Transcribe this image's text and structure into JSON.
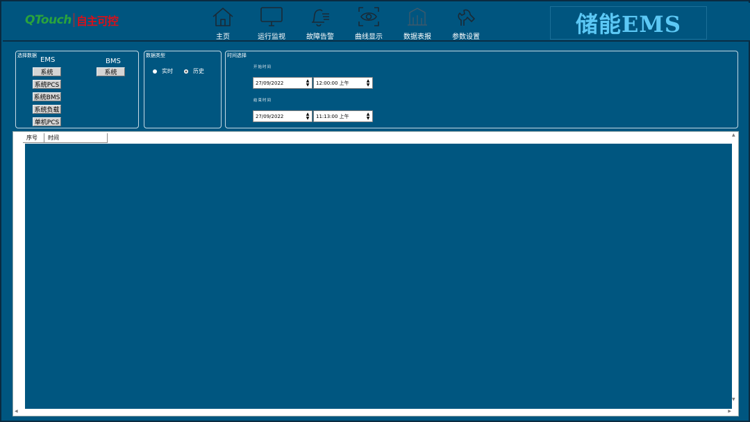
{
  "header": {
    "logo_latin": "QTouch",
    "logo_cn": "自主可控",
    "title": "储能EMS",
    "nav": [
      {
        "label": "主页",
        "icon": "home-icon"
      },
      {
        "label": "运行监视",
        "icon": "monitor-icon"
      },
      {
        "label": "故障告警",
        "icon": "alarm-bell-icon"
      },
      {
        "label": "曲线显示",
        "icon": "eye-scan-icon"
      },
      {
        "label": "数据表报",
        "icon": "report-icon"
      },
      {
        "label": "参数设置",
        "icon": "settings-icon"
      }
    ]
  },
  "select_data": {
    "title": "选择数据",
    "ems_label": "EMS",
    "bms_label": "BMS",
    "ems_buttons": [
      "系统",
      "系统PCS",
      "系统BMS",
      "系统负载",
      "单机PCS"
    ],
    "bms_buttons": [
      "系统"
    ]
  },
  "data_type": {
    "title": "数据类型",
    "options": [
      {
        "label": "实时",
        "selected": false
      },
      {
        "label": "历史",
        "selected": true
      }
    ]
  },
  "time_select": {
    "title": "时间选择",
    "start_label": "开始时间",
    "start_date": "27/09/2022",
    "start_time": "12:00:00 上午",
    "end_label": "结束时间",
    "end_date": "27/09/2022",
    "end_time": "11:13:00 上午"
  },
  "table": {
    "columns": [
      "序号",
      "时间"
    ]
  },
  "colors": {
    "background": "#005680",
    "title": "#5cc8f5",
    "logo_green": "#2aa33d",
    "logo_red": "#d8101a"
  }
}
